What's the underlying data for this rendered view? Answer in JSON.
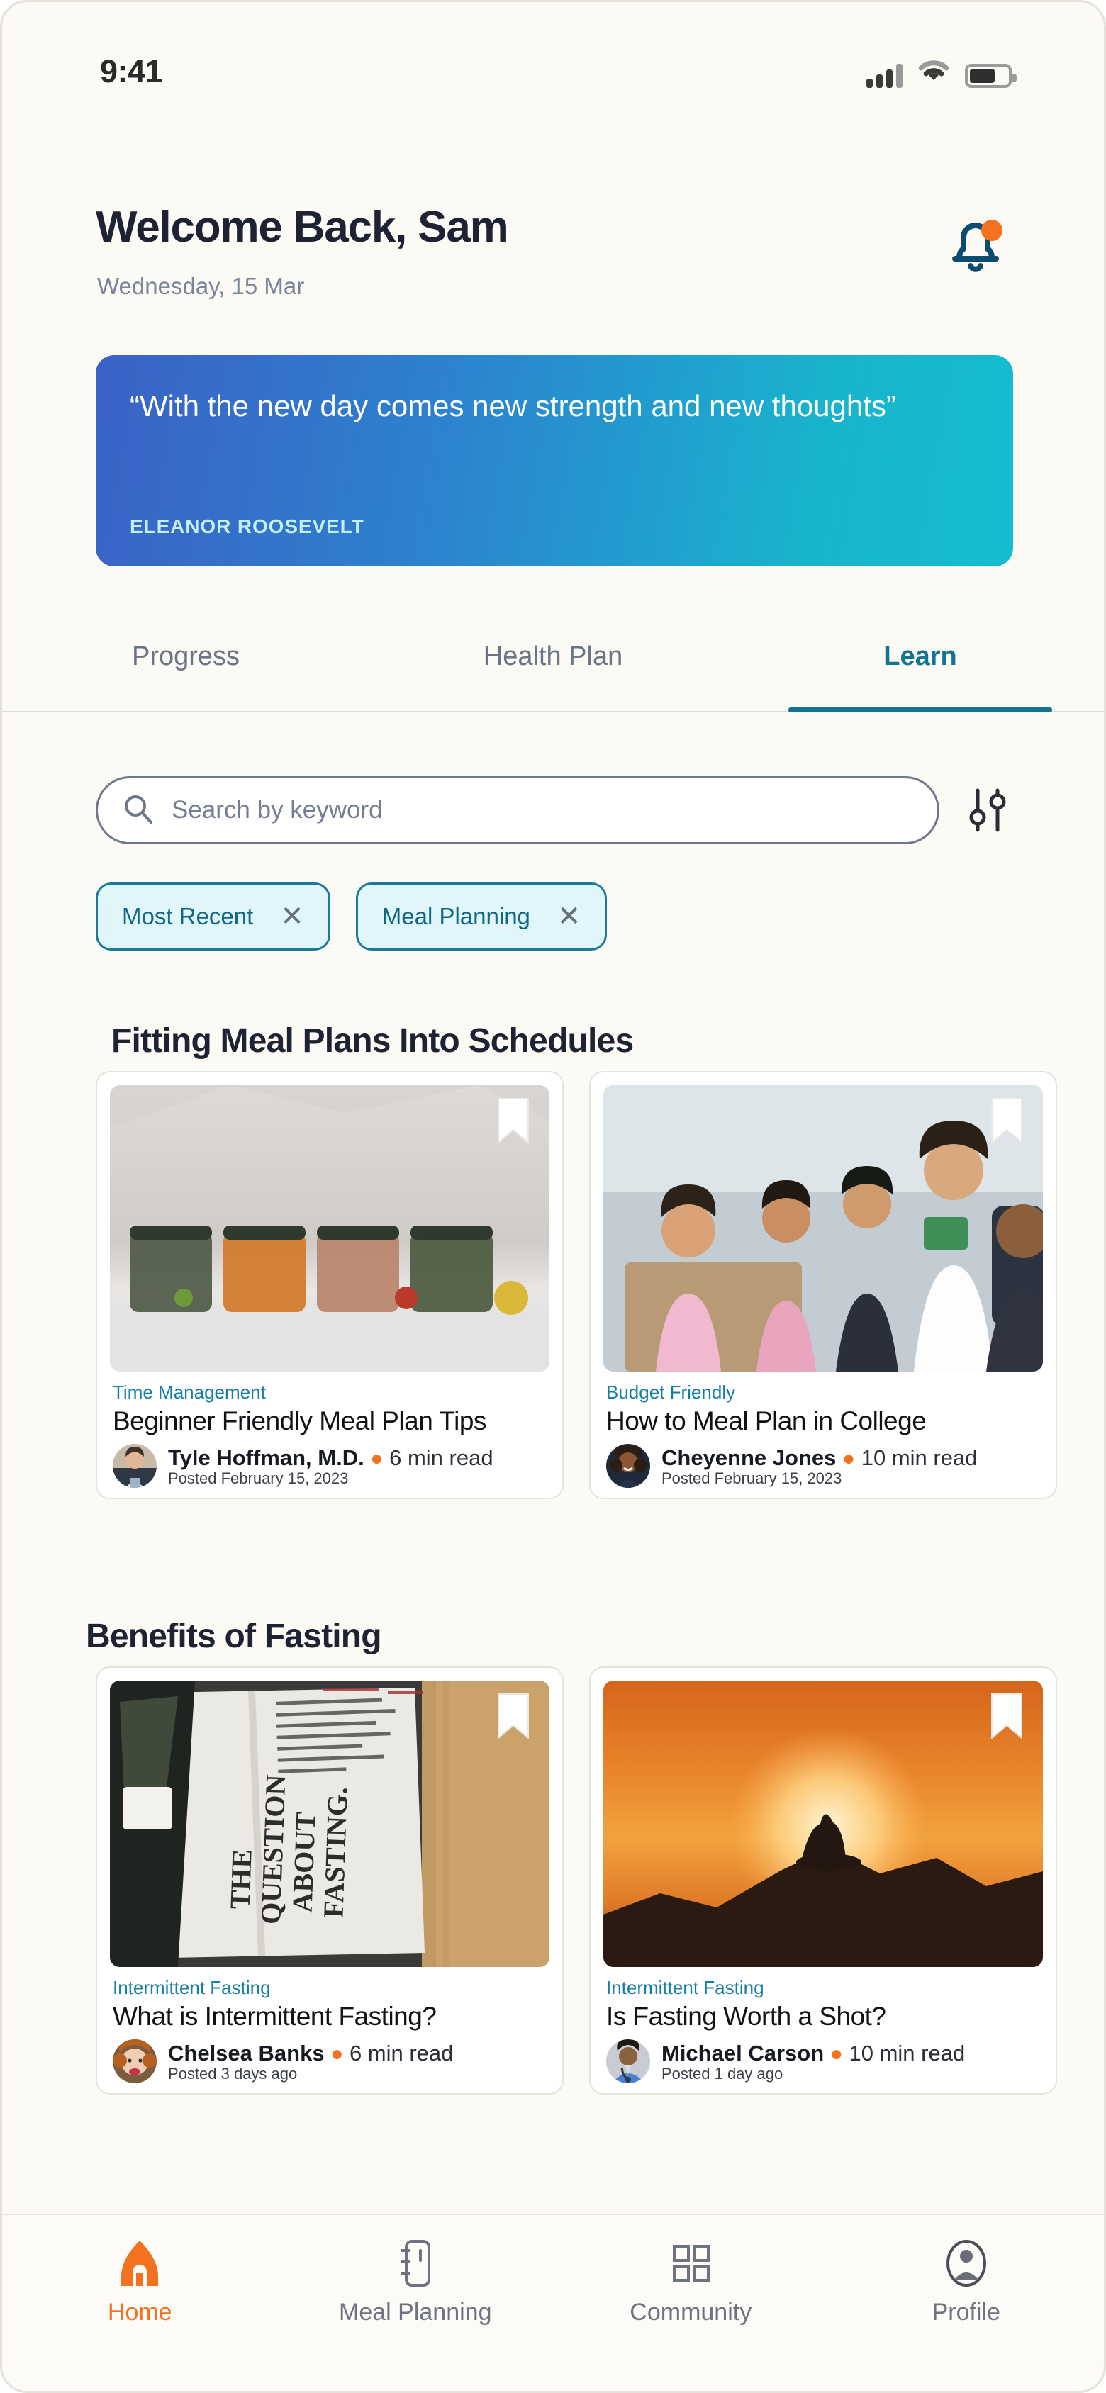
{
  "statusbar": {
    "time": "9:41",
    "signal_icon": "signal-bars-icon",
    "wifi_icon": "wifi-icon",
    "battery_icon": "battery-icon",
    "battery_level": 68
  },
  "header": {
    "greeting": "Welcome Back, Sam",
    "date": "Wednesday, 15 Mar",
    "bell_icon": "bell-icon",
    "has_notification": true,
    "notification_dot_color": "#f4711f"
  },
  "quote_card": {
    "text": "“With the new day comes new strength and new thoughts”",
    "author": "ELEANOR ROOSEVELT",
    "gradient_start": "#3b61c6",
    "gradient_end": "#14bdd0"
  },
  "tabs": [
    {
      "label": "Progress",
      "active": false
    },
    {
      "label": "Health Plan",
      "active": false
    },
    {
      "label": "Learn",
      "active": true
    }
  ],
  "tab_accent_color": "#117493",
  "search": {
    "placeholder": "Search by keyword",
    "value": "",
    "search_icon": "search-icon",
    "filter_icon": "filter-sliders-icon"
  },
  "chips": [
    {
      "label": "Most Recent",
      "remove_icon": "close-icon"
    },
    {
      "label": "Meal Planning",
      "remove_icon": "close-icon"
    }
  ],
  "chip_colors": {
    "border": "#1b7a98",
    "background": "#e0f6fb",
    "text": "#106886"
  },
  "sections": [
    {
      "title": "Fitting Meal Plans Into Schedules",
      "cards": [
        {
          "tag": "Time Management",
          "title": "Beginner Friendly Meal Plan Tips",
          "author": "Tyle Hoffman, M.D.",
          "read_time": "6 min read",
          "posted": "Posted February 15, 2023",
          "bookmark_icon": "bookmark-icon",
          "image_alt": "meal-prep-jars-photo"
        },
        {
          "tag": "Budget Friendly",
          "title": "How to Meal Plan in College",
          "author": "Cheyenne Jones",
          "read_time": "10 min read",
          "posted": "Posted February 15, 2023",
          "bookmark_icon": "bookmark-icon",
          "image_alt": "college-students-classroom-photo"
        }
      ]
    },
    {
      "title": "Benefits of Fasting",
      "cards": [
        {
          "tag": "Intermittent Fasting",
          "title": "What is Intermittent Fasting?",
          "author": "Chelsea Banks",
          "read_time": "6 min read",
          "posted": "Posted 3 days ago",
          "bookmark_icon": "bookmark-icon",
          "image_alt": "open-book-question-about-fasting-photo"
        },
        {
          "tag": "Intermittent Fasting",
          "title": "Is Fasting Worth a Shot?",
          "author": "Michael Carson",
          "read_time": "10 min read",
          "posted": "Posted 1 day ago",
          "bookmark_icon": "bookmark-icon",
          "image_alt": "sunset-silhouette-person-on-hill-photo"
        }
      ]
    }
  ],
  "bottom_nav": [
    {
      "label": "Home",
      "icon": "home-icon",
      "active": true
    },
    {
      "label": "Meal Planning",
      "icon": "notebook-icon",
      "active": false
    },
    {
      "label": "Community",
      "icon": "grid-icon",
      "active": false
    },
    {
      "label": "Profile",
      "icon": "person-circle-icon",
      "active": false
    }
  ],
  "nav_active_color": "#f4711f",
  "accent_colors": {
    "tag_teal": "#157ea4",
    "bullet_orange": "#f4711f",
    "title_navy": "#1e2233",
    "page_background": "#fbfaf5"
  }
}
